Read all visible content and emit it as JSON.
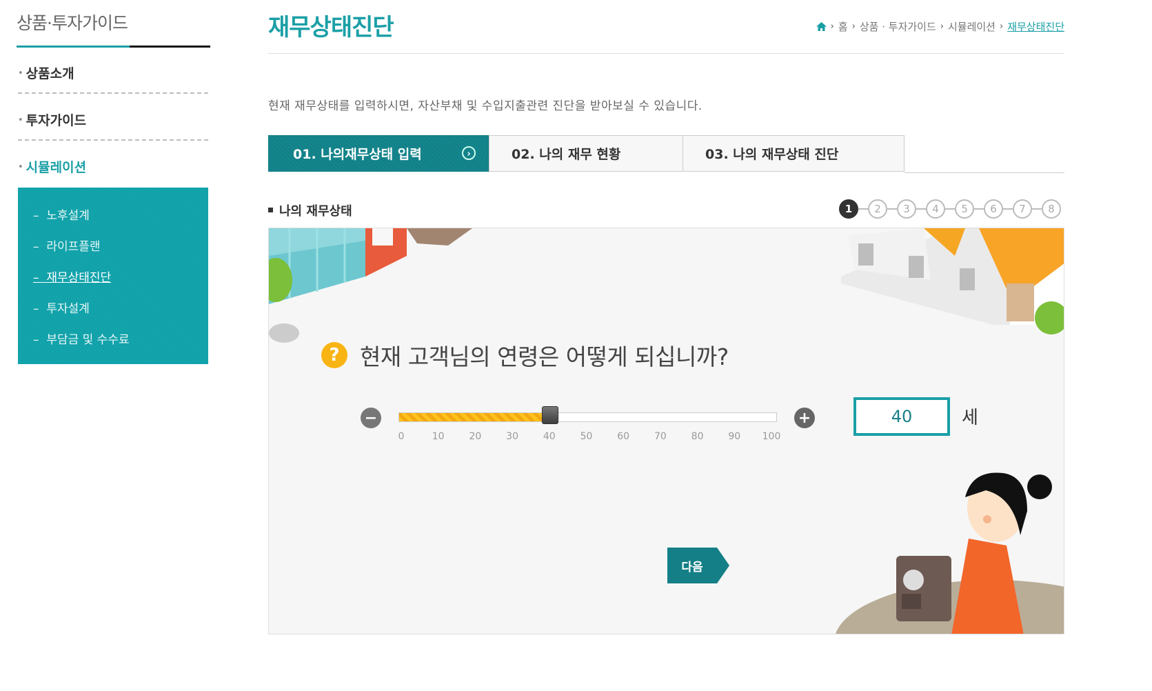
{
  "sidebar": {
    "title": "상품·투자가이드",
    "menu": [
      {
        "label": "상품소개"
      },
      {
        "label": "투자가이드"
      },
      {
        "label": "시뮬레이션"
      }
    ],
    "submenu": [
      {
        "label": "노후설계"
      },
      {
        "label": "라이프플랜"
      },
      {
        "label": "재무상태진단"
      },
      {
        "label": "투자설계"
      },
      {
        "label": "부담금 및 수수료"
      }
    ]
  },
  "header": {
    "title": "재무상태진단",
    "breadcrumb": [
      "홈",
      "상품 · 투자가이드",
      "시뮬레이션",
      "재무상태진단"
    ]
  },
  "intro": "현재 재무상태를 입력하시면, 자산부채 및 수입지출관련 진단을 받아보실 수 있습니다.",
  "steps": [
    {
      "label": "01. 나의재무상태 입력"
    },
    {
      "label": "02. 나의 재무 현황"
    },
    {
      "label": "03. 나의 재무상태 진단"
    }
  ],
  "section": {
    "title": "나의 재무상태",
    "pages": [
      "1",
      "2",
      "3",
      "4",
      "5",
      "6",
      "7",
      "8"
    ],
    "current_page": "1"
  },
  "question": {
    "icon": "question-mark-icon",
    "mark": "?",
    "text": "현재 고객님의 연령은 어떻게 되십니까?"
  },
  "slider": {
    "value": 40,
    "min": 0,
    "max": 100,
    "ticks": [
      "0",
      "10",
      "20",
      "30",
      "40",
      "50",
      "60",
      "70",
      "80",
      "90",
      "100"
    ],
    "minus": "−",
    "plus": "+"
  },
  "age": {
    "value": "40",
    "unit": "세"
  },
  "next_label": "다음",
  "colors": {
    "accent": "#1a9fa6",
    "dark_accent": "#147f86",
    "slider_fill": "#ffc21b"
  }
}
